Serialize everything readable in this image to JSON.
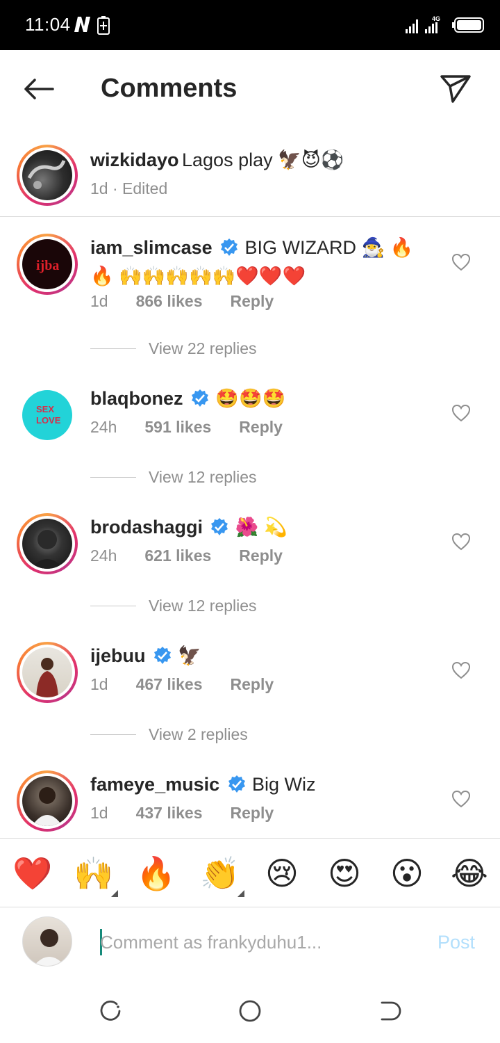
{
  "status_bar": {
    "time": "11:04",
    "network": "4G"
  },
  "header": {
    "title": "Comments"
  },
  "caption": {
    "username": "wizkidayo",
    "text": "Lagos play 🦅😈⚽",
    "meta": "1d · Edited"
  },
  "comments": [
    {
      "username": "iam_slimcase",
      "verified": true,
      "text": "BIG WIZARD 🧙‍♂️ 🔥 🔥 🙌🙌🙌🙌🙌❤️❤️❤️",
      "time": "1d",
      "likes": "866 likes",
      "reply": "Reply",
      "view_replies": "View 22 replies"
    },
    {
      "username": "blaqbonez",
      "verified": true,
      "text": "🤩🤩🤩",
      "time": "24h",
      "likes": "591 likes",
      "reply": "Reply",
      "view_replies": "View 12 replies"
    },
    {
      "username": "brodashaggi",
      "verified": true,
      "text": "🌺 💫",
      "time": "24h",
      "likes": "621 likes",
      "reply": "Reply",
      "view_replies": "View 12 replies"
    },
    {
      "username": "ijebuu",
      "verified": true,
      "text": "🦅",
      "time": "1d",
      "likes": "467 likes",
      "reply": "Reply",
      "view_replies": "View 2 replies"
    },
    {
      "username": "fameye_music",
      "verified": true,
      "text": "Big Wiz",
      "time": "1d",
      "likes": "437 likes",
      "reply": "Reply"
    }
  ],
  "reactions": [
    "❤️",
    "🙌",
    "🔥",
    "👏",
    "😢",
    "😍",
    "😮",
    "😂"
  ],
  "input": {
    "placeholder": "Comment as frankyduhu1...",
    "post_label": "Post"
  },
  "colors": {
    "verified": "#3897f0",
    "post_disabled": "#b2dffc",
    "meta": "#8e8e8e"
  },
  "icons": {
    "back": "arrow-left-icon",
    "send": "paper-plane-icon",
    "like": "heart-outline-icon"
  }
}
